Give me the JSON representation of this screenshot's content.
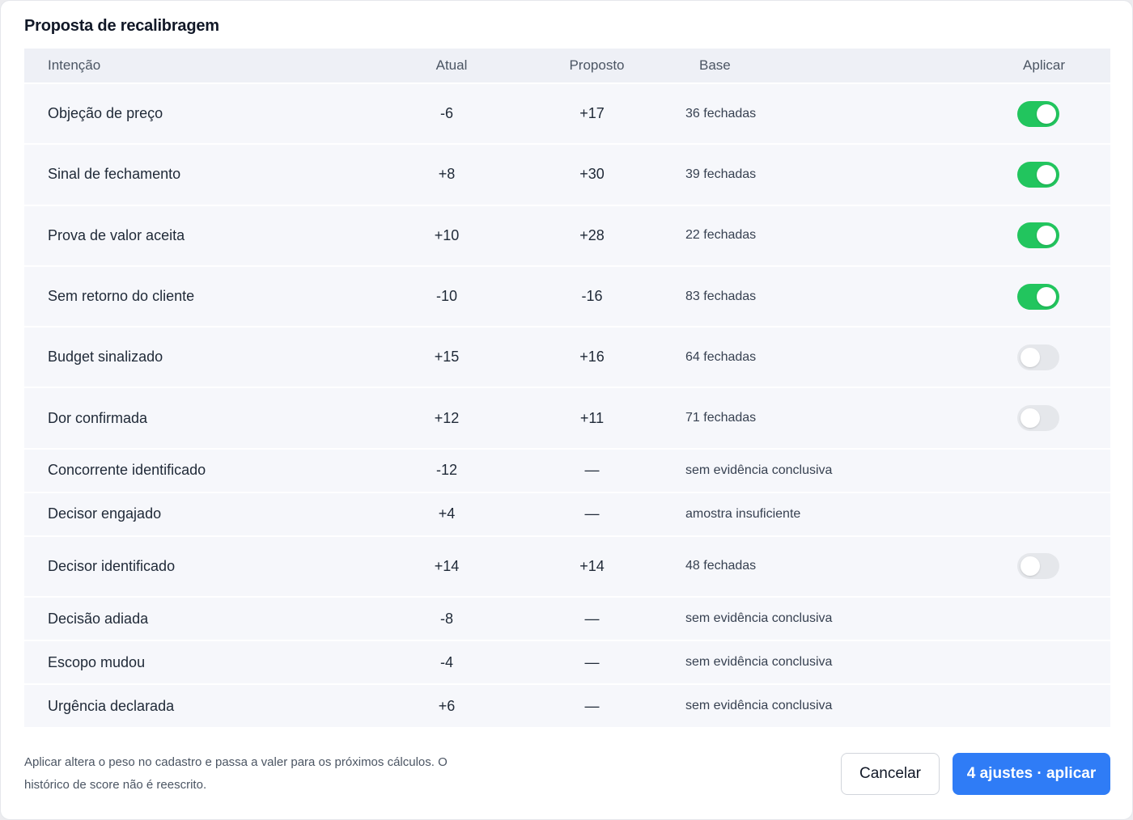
{
  "title": "Proposta de recalibragem",
  "columns": {
    "intent": "Intenção",
    "current": "Atual",
    "proposed": "Proposto",
    "base": "Base",
    "apply": "Aplicar"
  },
  "rows": [
    {
      "intent": "Objeção de preço",
      "current": "-6",
      "proposed": "+17",
      "base": "36 fechadas",
      "toggle": "on"
    },
    {
      "intent": "Sinal de fechamento",
      "current": "+8",
      "proposed": "+30",
      "base": "39 fechadas",
      "toggle": "on"
    },
    {
      "intent": "Prova de valor aceita",
      "current": "+10",
      "proposed": "+28",
      "base": "22 fechadas",
      "toggle": "on"
    },
    {
      "intent": "Sem retorno do cliente",
      "current": "-10",
      "proposed": "-16",
      "base": "83 fechadas",
      "toggle": "on"
    },
    {
      "intent": "Budget sinalizado",
      "current": "+15",
      "proposed": "+16",
      "base": "64 fechadas",
      "toggle": "off"
    },
    {
      "intent": "Dor confirmada",
      "current": "+12",
      "proposed": "+11",
      "base": "71 fechadas",
      "toggle": "off"
    },
    {
      "intent": "Concorrente identificado",
      "current": "-12",
      "proposed": "—",
      "base": "sem evidência conclusiva",
      "toggle": "none"
    },
    {
      "intent": "Decisor engajado",
      "current": "+4",
      "proposed": "—",
      "base": "amostra insuficiente",
      "toggle": "none"
    },
    {
      "intent": "Decisor identificado",
      "current": "+14",
      "proposed": "+14",
      "base": "48 fechadas",
      "toggle": "off"
    },
    {
      "intent": "Decisão adiada",
      "current": "-8",
      "proposed": "—",
      "base": "sem evidência conclusiva",
      "toggle": "none"
    },
    {
      "intent": "Escopo mudou",
      "current": "-4",
      "proposed": "—",
      "base": "sem evidência conclusiva",
      "toggle": "none"
    },
    {
      "intent": "Urgência declarada",
      "current": "+6",
      "proposed": "—",
      "base": "sem evidência conclusiva",
      "toggle": "none"
    }
  ],
  "footer": {
    "note": "Aplicar altera o peso no cadastro e passa a valer para os próximos cálculos. O histórico de score não é reescrito.",
    "cancel_label": "Cancelar",
    "apply_label": "4 ajustes · aplicar"
  },
  "colors": {
    "toggle_on": "#22c55e",
    "toggle_off": "#e5e7eb",
    "primary": "#2f7cf6"
  }
}
